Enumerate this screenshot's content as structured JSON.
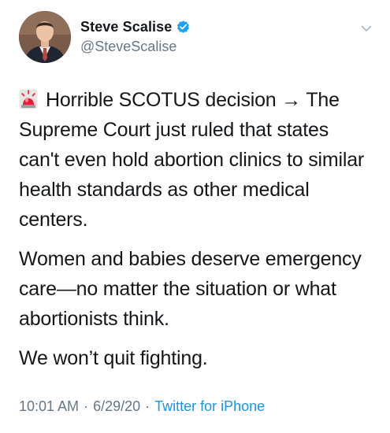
{
  "tweet": {
    "author": {
      "display_name": "Steve Scalise",
      "handle": "@SteveScalise",
      "verified": true
    },
    "body": {
      "line1_text": "Horrible SCOTUS decision → The Supreme Court just ruled that states can't even hold abortion clinics to similar health standards as other medical centers.",
      "paragraph2": "Women and babies deserve emergency care—no matter the situation or what abortionists think.",
      "paragraph3": "We won’t quit fighting."
    },
    "meta": {
      "time": "10:01 AM",
      "date": "6/29/20",
      "source": "Twitter for iPhone",
      "separator": "·"
    },
    "icons": {
      "alert": "police-light-icon",
      "verified": "verified-badge-icon",
      "menu": "chevron-down-icon"
    },
    "colors": {
      "text": "#14171a",
      "secondary": "#657786",
      "link": "#1b95e0",
      "verified": "#1da1f2"
    }
  }
}
